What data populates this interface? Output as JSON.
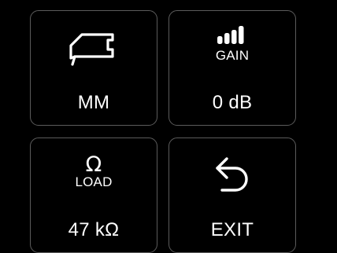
{
  "colors": {
    "background": "#000000",
    "tile_border": "#5c5c5c",
    "text": "#ffffff"
  },
  "tiles": {
    "cartridge": {
      "icon": "cartridge-icon",
      "value": "MM"
    },
    "gain": {
      "icon": "signal-bars-icon",
      "caption": "GAIN",
      "value": "0 dB"
    },
    "load": {
      "icon": "omega-icon",
      "glyph": "Ω",
      "caption": "LOAD",
      "value": "47 kΩ"
    },
    "exit": {
      "icon": "back-arrow-icon",
      "value": "EXIT"
    }
  }
}
